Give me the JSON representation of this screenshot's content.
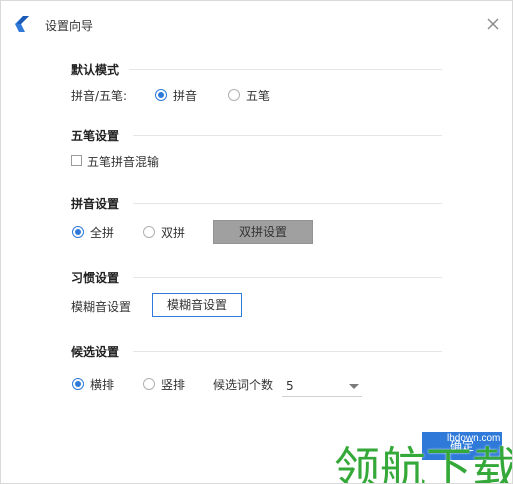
{
  "window": {
    "title": "设置向导"
  },
  "sections": {
    "default_mode": {
      "title": "默认模式",
      "field_label": "拼音/五笔:",
      "options": [
        {
          "label": "拼音",
          "checked": true
        },
        {
          "label": "五笔",
          "checked": false
        }
      ]
    },
    "wubi_settings": {
      "title": "五笔设置",
      "checkbox_label": "五笔拼音混输",
      "checked": false
    },
    "pinyin_settings": {
      "title": "拼音设置",
      "options": [
        {
          "label": "全拼",
          "checked": true
        },
        {
          "label": "双拼",
          "checked": false
        }
      ],
      "button_label": "双拼设置"
    },
    "habit_settings": {
      "title": "习惯设置",
      "field_label": "模糊音设置",
      "button_label": "模糊音设置"
    },
    "candidate_settings": {
      "title": "候选设置",
      "options": [
        {
          "label": "横排",
          "checked": true
        },
        {
          "label": "竖排",
          "checked": false
        }
      ],
      "count_label": "候选词个数",
      "count_value": "5"
    }
  },
  "footer": {
    "ok_label": "确定"
  },
  "watermark": {
    "text": "领航下载",
    "site": "lhdown.com"
  },
  "colors": {
    "accent": "#2f7ad9",
    "disabled_button": "#a0a0a0",
    "watermark": "#35a83a"
  },
  "icons": {
    "app": "app-logo-icon",
    "close": "close-icon"
  }
}
